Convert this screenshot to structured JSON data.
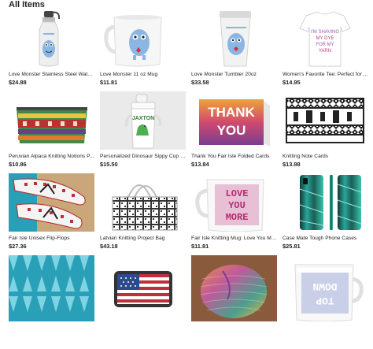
{
  "heading": "All Items",
  "colors": {
    "monster_blue": "#8ab6e3",
    "heart_red": "#d8303a",
    "pink": "#c9397d",
    "teal": "#2aa0b8"
  },
  "items": [
    {
      "title": "Love Monster Stainless Steel Wate...",
      "price": "$24.88",
      "image": "water-bottle-image"
    },
    {
      "title": "Love Monster 11 oz Mug",
      "price": "$11.81",
      "image": "mug-image"
    },
    {
      "title": "Love Monster Tumbler 20oz",
      "price": "$33.58",
      "image": "tumbler-image"
    },
    {
      "title": "Women's Favorite Tee: Perfect for ...",
      "price": "$14.95",
      "image": "tshirt-image",
      "shirt_text": [
        "I'M SHAVING",
        "MY DYE",
        "FOR MY",
        "YARN"
      ]
    },
    {
      "title": "Peruvian Alpaca Knitting Notions P...",
      "price": "$10.86",
      "image": "pouch-image"
    },
    {
      "title": "Personalized Dinosaur Sippy Cup (...",
      "price": "$15.50",
      "image": "sippy-cup-image",
      "cup_text": "JAXTON"
    },
    {
      "title": "Thank You Fair Isle Folded Cards",
      "price": "$13.84",
      "image": "thank-you-card-image",
      "card_text": [
        "THANK",
        "YOU"
      ]
    },
    {
      "title": "Knitting Note Cards",
      "price": "$13.88",
      "image": "note-card-image"
    },
    {
      "title": "Fair Isle Unisex Flip-Flops",
      "price": "$27.36",
      "image": "flip-flops-image"
    },
    {
      "title": "Latvian Knitting Project Bag",
      "price": "$43.18",
      "image": "project-bag-image"
    },
    {
      "title": "Fair Isle Knitting Mug: Love You Mo...",
      "price": "$11.81",
      "image": "love-mug-image",
      "mug_text": [
        "LOVE",
        "YOU",
        "MORE"
      ]
    },
    {
      "title": "Case Mate Tough Phone Cases",
      "price": "$25.81",
      "image": "phone-case-image"
    },
    {
      "title": "",
      "price": "",
      "image": "geometric-print-image"
    },
    {
      "title": "",
      "price": "",
      "image": "flag-pouch-image"
    },
    {
      "title": "",
      "price": "",
      "image": "knit-bag-image"
    },
    {
      "title": "",
      "price": "",
      "image": "top-down-mug-image",
      "mug_text": [
        "TOP",
        "DOWN"
      ]
    }
  ]
}
